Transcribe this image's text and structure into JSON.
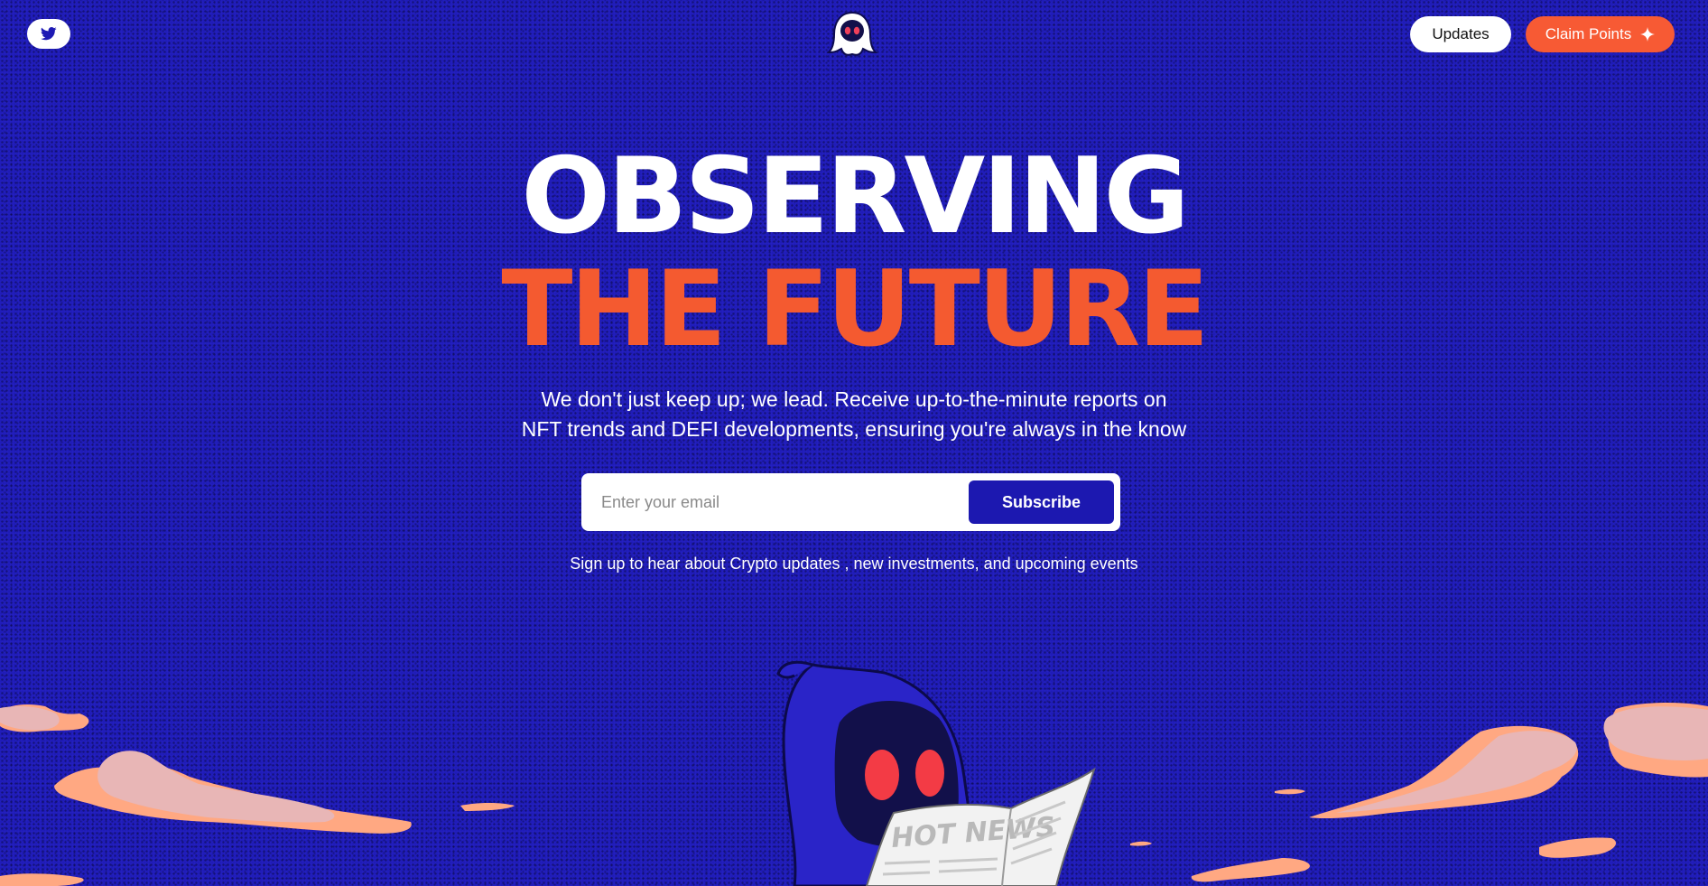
{
  "header": {
    "twitter_icon": "twitter-bird-icon",
    "logo_icon": "ghost-logo-icon",
    "updates_label": "Updates",
    "claim_label": "Claim Points",
    "claim_icon": "sparkle-icon"
  },
  "hero": {
    "line1": "OBSERVING",
    "line2": "THE FUTURE",
    "subtitle_line1": "We don't just keep up; we lead. Receive up-to-the-minute reports on",
    "subtitle_line2": "NFT trends and DEFI developments, ensuring you're always in the know"
  },
  "subscribe": {
    "placeholder": "Enter your email",
    "value": "",
    "button_label": "Subscribe",
    "note": "Sign up to hear about Crypto updates , new investments, and upcoming events"
  },
  "illustration": {
    "newspaper_headline": "HOT NEWS"
  },
  "colors": {
    "background": "#1e1ab4",
    "accent": "#f45a30",
    "button_dark": "#1c18b0",
    "white": "#ffffff"
  }
}
